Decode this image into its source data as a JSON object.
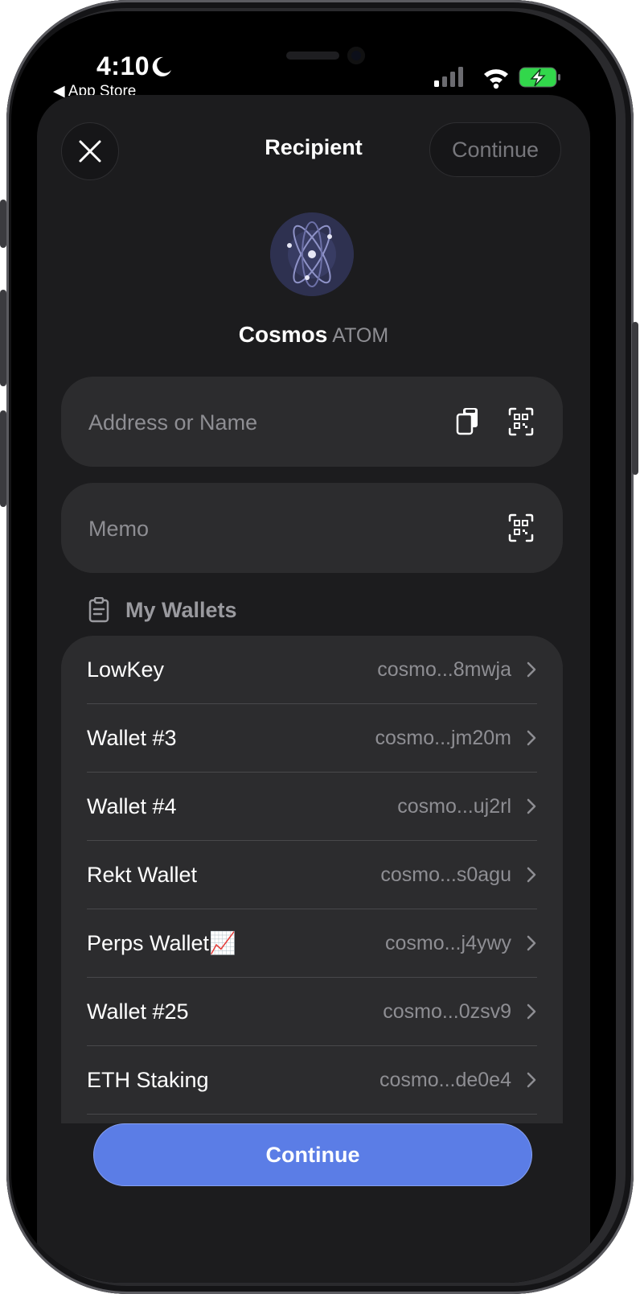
{
  "status_bar": {
    "time": "4:10",
    "back_app_label": "◀ App Store",
    "battery_color": "#32d74b"
  },
  "header": {
    "title": "Recipient",
    "continue_label": "Continue"
  },
  "token": {
    "name": "Cosmos",
    "symbol": "ATOM",
    "logo_icon": "cosmos-atom-icon"
  },
  "address_field": {
    "placeholder": "Address or Name",
    "value": ""
  },
  "memo_field": {
    "placeholder": "Memo",
    "value": ""
  },
  "my_wallets": {
    "title": "My Wallets",
    "items": [
      {
        "name": "LowKey",
        "address": "cosmo...8mwja"
      },
      {
        "name": "Wallet #3",
        "address": "cosmo...jm20m"
      },
      {
        "name": "Wallet #4",
        "address": "cosmo...uj2rl"
      },
      {
        "name": "Rekt Wallet",
        "address": "cosmo...s0agu"
      },
      {
        "name": "Perps Wallet📈",
        "address": "cosmo...j4ywy"
      },
      {
        "name": "Wallet #25",
        "address": "cosmo...0zsv9"
      },
      {
        "name": "ETH Staking",
        "address": "cosmo...de0e4"
      }
    ]
  },
  "footer": {
    "continue_label": "Continue",
    "accent_color": "#5b7de6"
  }
}
